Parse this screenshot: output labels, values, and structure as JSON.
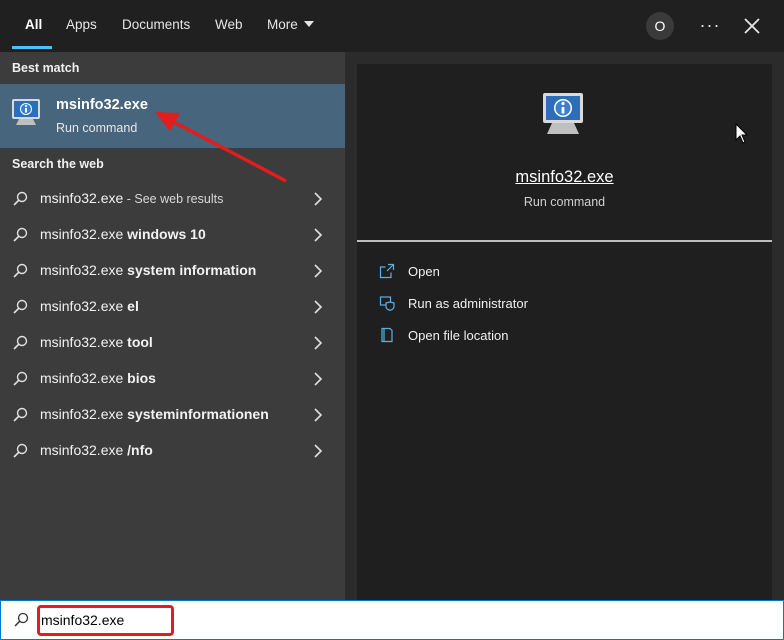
{
  "tabs": [
    {
      "label": "All",
      "active": true
    },
    {
      "label": "Apps"
    },
    {
      "label": "Documents"
    },
    {
      "label": "Web"
    },
    {
      "label": "More"
    }
  ],
  "header": {
    "avatar_letter": "O",
    "more_options": "···"
  },
  "sections": {
    "best_match": "Best match",
    "search_web": "Search the web"
  },
  "best_match": {
    "title": "msinfo32.exe",
    "subtitle": "Run command",
    "icon": "system-info-icon"
  },
  "web_results": [
    {
      "query": "msinfo32.exe",
      "suffix": "",
      "hint": " - See web results"
    },
    {
      "query": "msinfo32.exe",
      "suffix": " windows 10",
      "hint": ""
    },
    {
      "query": "msinfo32.exe",
      "suffix": " system information",
      "hint": ""
    },
    {
      "query": "msinfo32.exe",
      "suffix": " el",
      "hint": ""
    },
    {
      "query": "msinfo32.exe",
      "suffix": " tool",
      "hint": ""
    },
    {
      "query": "msinfo32.exe",
      "suffix": " bios",
      "hint": ""
    },
    {
      "query": "msinfo32.exe",
      "suffix": " systeminformationen",
      "hint": ""
    },
    {
      "query": "msinfo32.exe",
      "suffix": " /nfo",
      "hint": ""
    }
  ],
  "preview": {
    "title": "msinfo32.exe",
    "subtitle": "Run command",
    "actions": [
      {
        "label": "Open",
        "icon": "open-icon"
      },
      {
        "label": "Run as administrator",
        "icon": "shield-icon"
      },
      {
        "label": "Open file location",
        "icon": "folder-icon"
      }
    ]
  },
  "search": {
    "value": "msinfo32.exe"
  },
  "colors": {
    "accent": "#4cc2ff",
    "selected": "#47657d",
    "annotation": "#e11d1d"
  }
}
